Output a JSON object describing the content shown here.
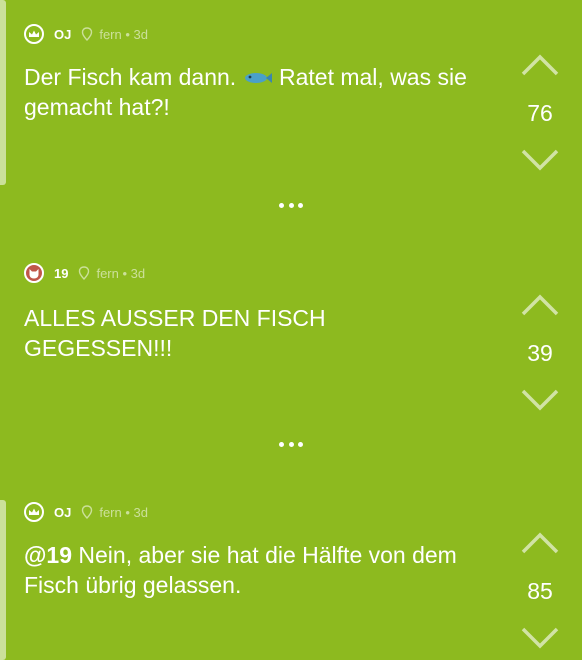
{
  "posts": [
    {
      "author": "OJ",
      "avatar_icon": "crown-icon",
      "location": "fern • 3d",
      "text_before": "Der Fisch kam dann. ",
      "emoji": "fish-icon",
      "text_after": " Ratet mal, was sie gemacht hat?!",
      "score": "76"
    },
    {
      "author": "19",
      "avatar_icon": "cat-face-icon",
      "avatar_color": "#c0574a",
      "location": "fern • 3d",
      "text": "ALLES AUSSER DEN FISCH GEGESSEN!!!",
      "score": "39"
    },
    {
      "author": "OJ",
      "avatar_icon": "crown-icon",
      "location": "fern • 3d",
      "mention": "@19",
      "text": " Nein, aber sie hat die Hälfte von dem Fisch übrig gelassen.",
      "score": "85"
    }
  ],
  "colors": {
    "background": "#8dba1f",
    "text": "#ffffff"
  }
}
